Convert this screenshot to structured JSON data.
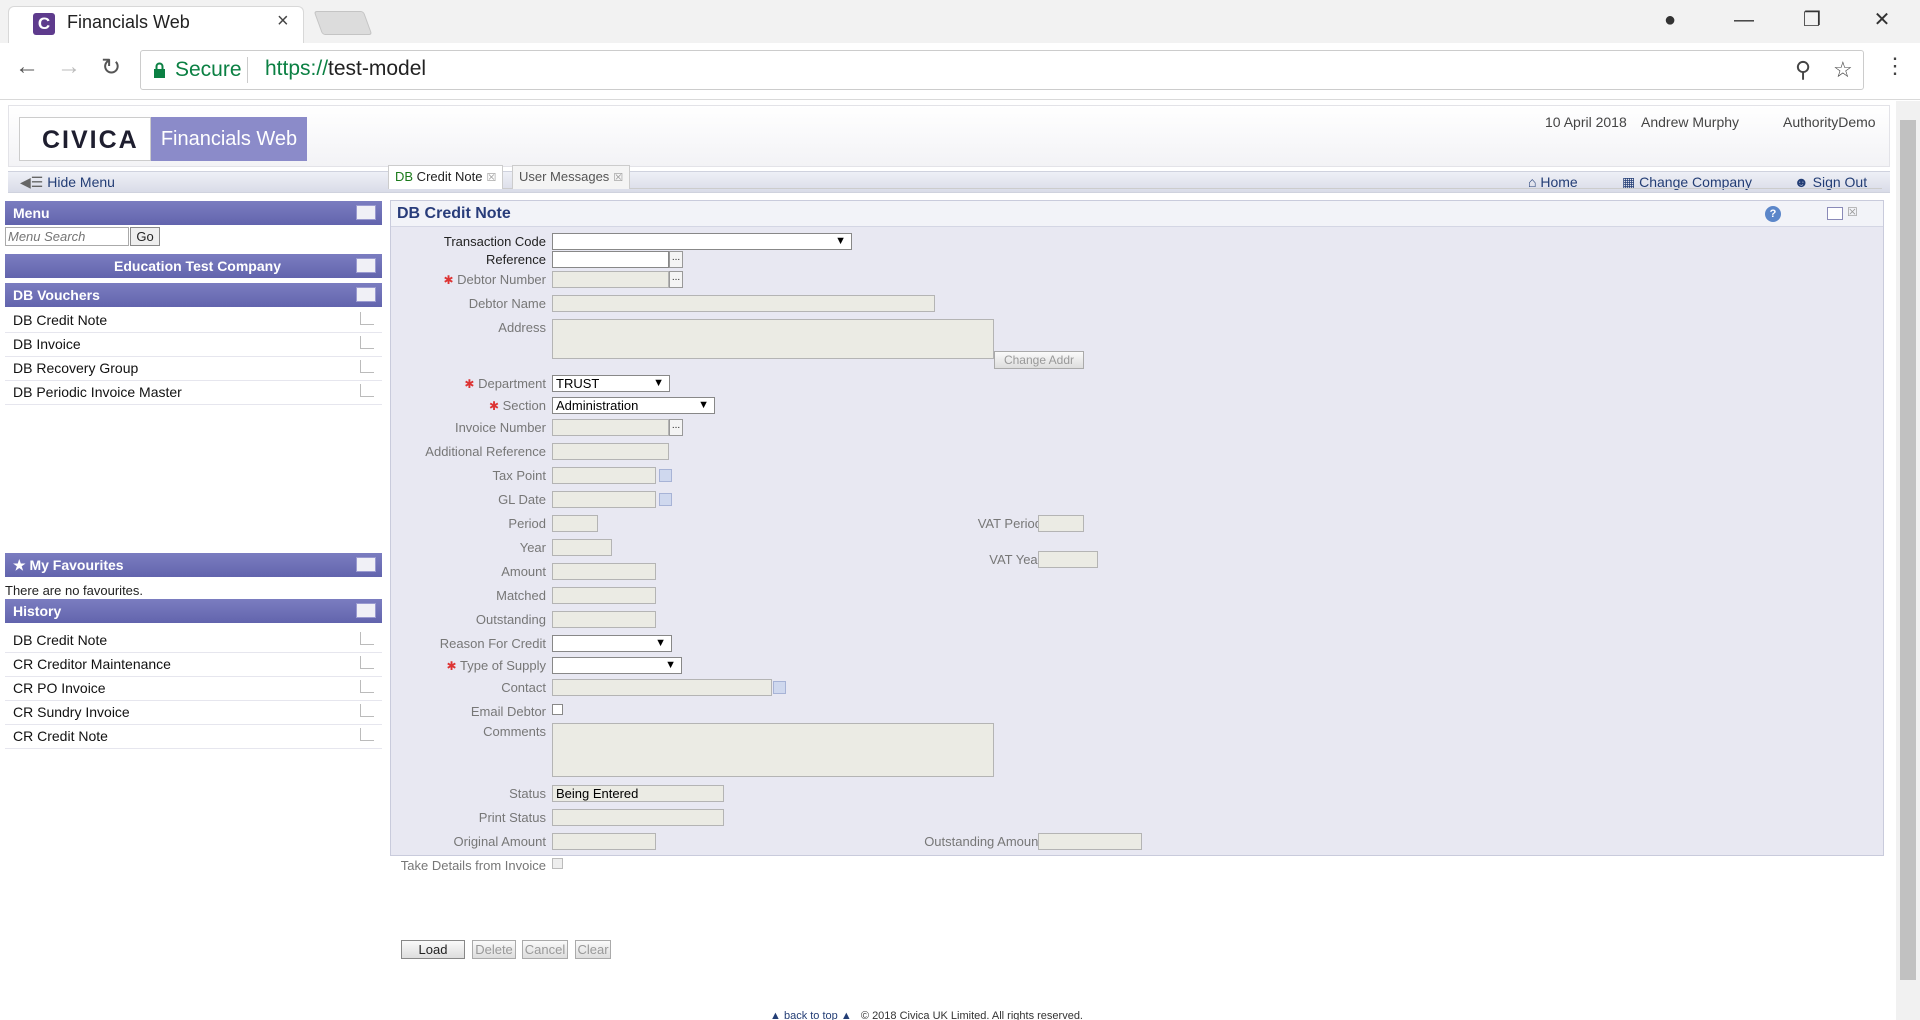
{
  "browser": {
    "tab_title": "Financials Web",
    "tab_close": "×",
    "favicon_letter": "C",
    "secure_label": "Secure",
    "url_scheme": "https://",
    "url_host": "test-model"
  },
  "header": {
    "logo": "CIVICA",
    "brand": "Financials Web",
    "date": "10 April 2018",
    "user": "Andrew Murphy",
    "authority": "AuthorityDemo"
  },
  "subbar": {
    "hide_menu": "Hide Menu",
    "home": "Home",
    "change_company": "Change Company",
    "sign_out": "Sign Out"
  },
  "sidebar": {
    "menu_title": "Menu",
    "search_placeholder": "Menu Search",
    "go": "Go",
    "company": "Education Test Company",
    "vouchers_title": "DB Vouchers",
    "vouchers": [
      "DB Credit Note",
      "DB Invoice",
      "DB Recovery Group",
      "DB Periodic Invoice Master"
    ],
    "favourites_title": "My Favourites",
    "no_favourites": "There are no favourites.",
    "history_title": "History",
    "history": [
      "DB Credit Note",
      "CR Creditor Maintenance",
      "CR PO Invoice",
      "CR Sundry Invoice",
      "CR Credit Note"
    ]
  },
  "tabs": [
    {
      "label_prefix": "DB",
      "label": " Credit Note"
    },
    {
      "label": "User Messages"
    }
  ],
  "form": {
    "title": "DB Credit Note",
    "labels": {
      "transaction_code": "Transaction Code",
      "reference": "Reference",
      "debtor_number": "Debtor Number",
      "debtor_name": "Debtor Name",
      "address": "Address",
      "department": "Department",
      "section": "Section",
      "invoice_number": "Invoice Number",
      "additional_reference": "Additional Reference",
      "tax_point": "Tax Point",
      "gl_date": "GL Date",
      "period": "Period",
      "vat_period": "VAT Period",
      "year": "Year",
      "vat_year": "VAT Year",
      "amount": "Amount",
      "matched": "Matched",
      "outstanding": "Outstanding",
      "reason_for_credit": "Reason For Credit",
      "type_of_supply": "Type of Supply",
      "contact": "Contact",
      "email_debtor": "Email Debtor",
      "comments": "Comments",
      "status": "Status",
      "print_status": "Print Status",
      "original_amount": "Original Amount",
      "outstanding_amount": "Outstanding Amount",
      "take_details": "Take Details from Invoice"
    },
    "values": {
      "department": "TRUST",
      "section": "Administration",
      "status": "Being Entered"
    },
    "change_addr": "Change Addr",
    "required_mark": "✱",
    "lookup": "..."
  },
  "buttons": {
    "load": "Load",
    "delete": "Delete",
    "cancel": "Cancel",
    "clear": "Clear"
  },
  "footer": {
    "back_to_top": "back to top",
    "copyright": "© 2018 Civica UK Limited. All rights reserved."
  }
}
